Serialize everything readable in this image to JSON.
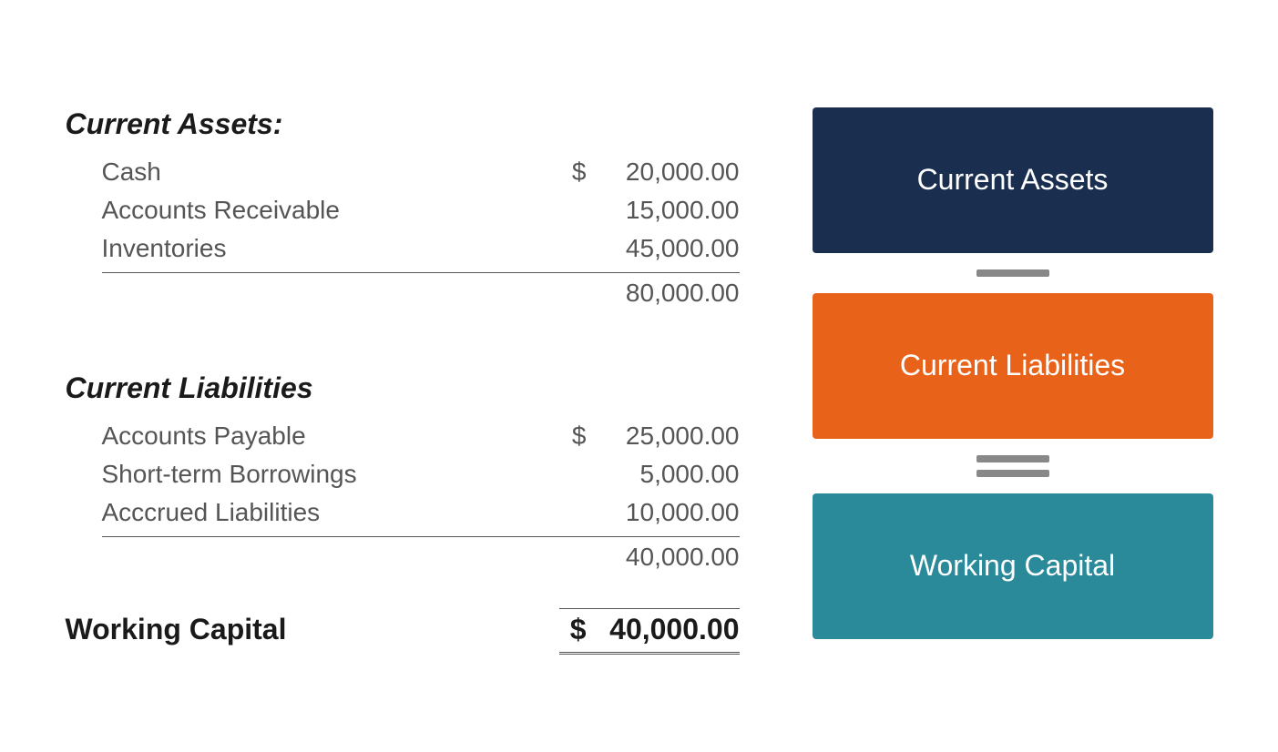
{
  "current_assets": {
    "header": "Current Assets:",
    "items": [
      {
        "label": "Cash",
        "dollar": "$",
        "amount": "20,000.00"
      },
      {
        "label": "Accounts Receivable",
        "dollar": "",
        "amount": "15,000.00"
      },
      {
        "label": "Inventories",
        "dollar": "",
        "amount": "45,000.00"
      }
    ],
    "subtotal": "80,000.00"
  },
  "current_liabilities": {
    "header": "Current Liabilities",
    "items": [
      {
        "label": "Accounts Payable",
        "dollar": "$",
        "amount": "25,000.00"
      },
      {
        "label": "Short-term Borrowings",
        "dollar": "",
        "amount": "5,000.00"
      },
      {
        "label": "Acccrued Liabilities",
        "dollar": "",
        "amount": "10,000.00"
      }
    ],
    "subtotal": "40,000.00"
  },
  "working_capital": {
    "label": "Working Capital",
    "dollar": "$",
    "amount": "40,000.00"
  },
  "right_panel": {
    "box1_label": "Current Assets",
    "box2_label": "Current Liabilities",
    "box3_label": "Working Capital"
  }
}
